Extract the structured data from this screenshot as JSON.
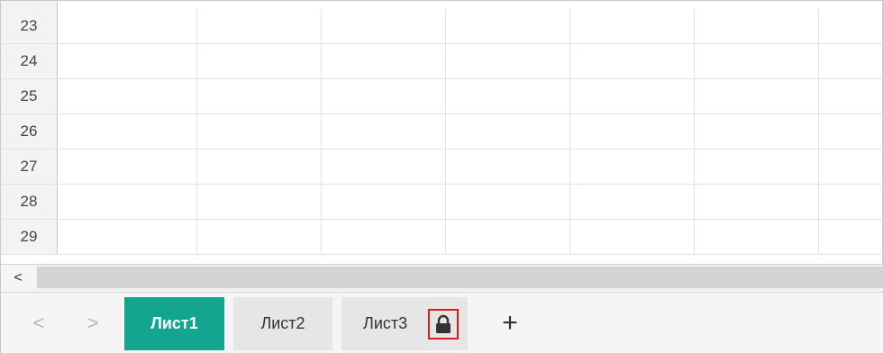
{
  "grid": {
    "rows": [
      "23",
      "24",
      "25",
      "26",
      "27",
      "28",
      "29"
    ]
  },
  "scroll": {
    "left_arrow": "<"
  },
  "tabs": {
    "prev_arrow": "<",
    "next_arrow": ">",
    "items": [
      {
        "label": "Лист1",
        "active": true
      },
      {
        "label": "Лист2",
        "active": false
      },
      {
        "label": "Лист3",
        "active": false,
        "locked": true
      }
    ],
    "add_label": "+"
  },
  "colors": {
    "active_tab": "#13a58f",
    "lock_highlight": "#e21b1b"
  },
  "icons": [
    "lock-icon",
    "chevron-left-icon",
    "chevron-right-icon",
    "plus-icon"
  ]
}
